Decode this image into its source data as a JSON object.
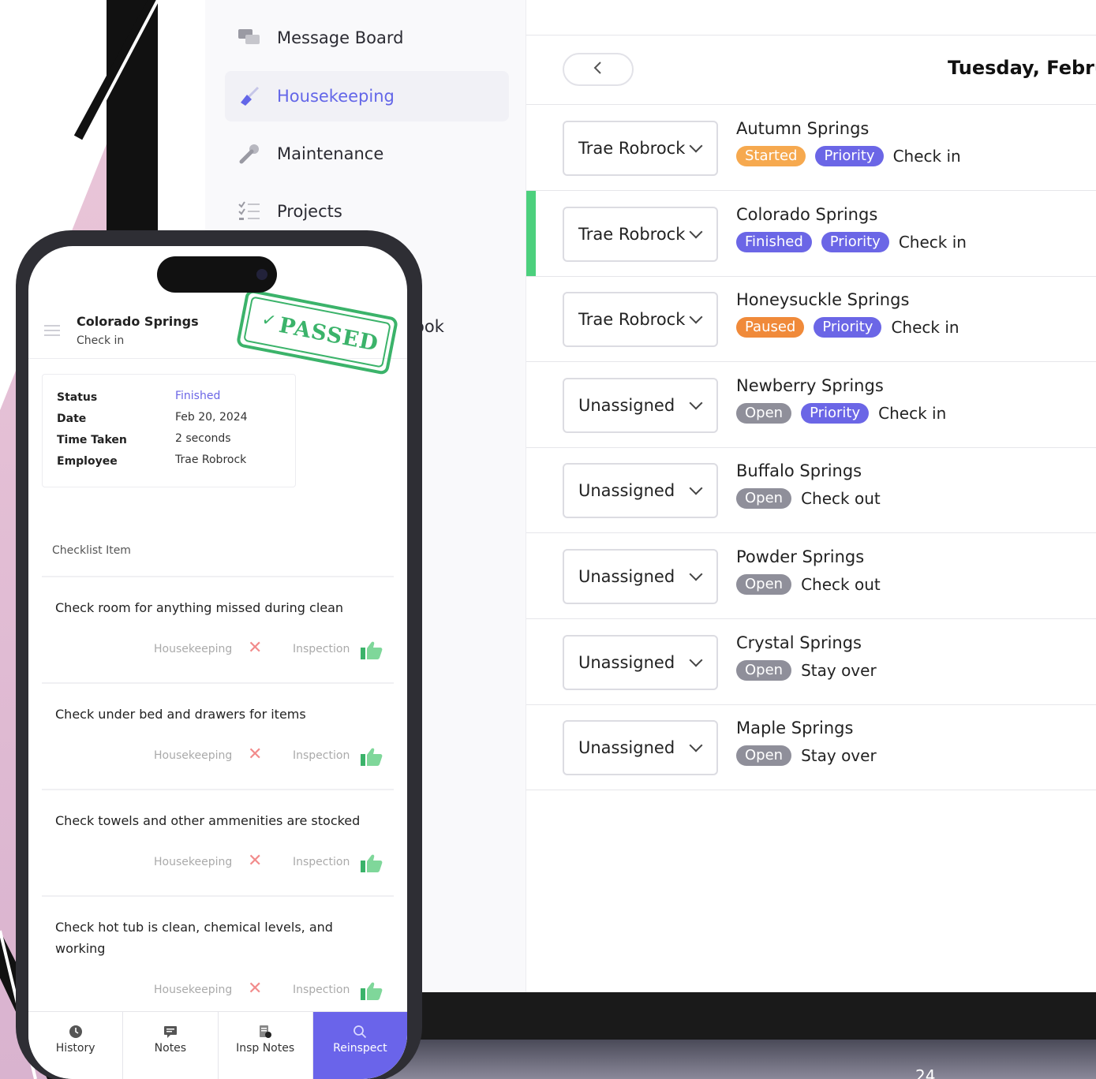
{
  "colors": {
    "accent": "#6366e8",
    "started": "#f6a94f",
    "paused": "#f08a3a",
    "finished": "#6b66e6",
    "priority": "#6b66e6",
    "open": "#8f8f9a",
    "active_row": "#4cd07d",
    "passed_stamp": "#3bb36a"
  },
  "sidebar": {
    "items": [
      {
        "label": "Message Board",
        "icon": "chat-bubbles-icon"
      },
      {
        "label": "Housekeeping",
        "icon": "broom-icon",
        "active": true
      },
      {
        "label": "Maintenance",
        "icon": "wrench-icon"
      },
      {
        "label": "Projects",
        "icon": "checklist-icon"
      }
    ],
    "partial_label": "ook"
  },
  "main": {
    "back_icon": "chevron-left-icon",
    "date_title": "Tuesday, Februa",
    "rows": [
      {
        "assignee": "Trae Robrock",
        "property": "Autumn Springs",
        "status": "Started",
        "priority": "Priority",
        "type": "Check in"
      },
      {
        "assignee": "Trae Robrock",
        "property": "Colorado Springs",
        "status": "Finished",
        "priority": "Priority",
        "type": "Check in",
        "selected": true
      },
      {
        "assignee": "Trae Robrock",
        "property": "Honeysuckle Springs",
        "status": "Paused",
        "priority": "Priority",
        "type": "Check in"
      },
      {
        "assignee": "Unassigned",
        "property": "Newberry Springs",
        "status": "Open",
        "priority": "Priority",
        "type": "Check in"
      },
      {
        "assignee": "Unassigned",
        "property": "Buffalo Springs",
        "status": "Open",
        "priority": "",
        "type": "Check out"
      },
      {
        "assignee": "Unassigned",
        "property": "Powder Springs",
        "status": "Open",
        "priority": "",
        "type": "Check out"
      },
      {
        "assignee": "Unassigned",
        "property": "Crystal Springs",
        "status": "Open",
        "priority": "",
        "type": "Stay over"
      },
      {
        "assignee": "Unassigned",
        "property": "Maple Springs",
        "status": "Open",
        "priority": "",
        "type": "Stay over"
      }
    ]
  },
  "phone": {
    "title": "Colorado Springs",
    "subtitle": "Check in",
    "stamp": "PASSED",
    "details": [
      {
        "key": "Status",
        "value": "Finished"
      },
      {
        "key": "Date",
        "value": "Feb 20, 2024"
      },
      {
        "key": "Time Taken",
        "value": "2 seconds"
      },
      {
        "key": "Employee",
        "value": "Trae Robrock"
      }
    ],
    "checklist_header": "Checklist Item",
    "checklist": [
      {
        "text": "Check room for anything missed during clean",
        "hk": "Housekeeping",
        "insp": "Inspection"
      },
      {
        "text": "Check under bed and drawers for items",
        "hk": "Housekeeping",
        "insp": "Inspection"
      },
      {
        "text": "Check towels and other ammenities are stocked",
        "hk": "Housekeeping",
        "insp": "Inspection"
      },
      {
        "text": "Check hot tub is clean, chemical levels, and working",
        "hk": "Housekeeping",
        "insp": "Inspection"
      }
    ],
    "tabs": [
      {
        "label": "History",
        "icon": "clock-icon"
      },
      {
        "label": "Notes",
        "icon": "notes-icon"
      },
      {
        "label": "Insp Notes",
        "icon": "insp-notes-icon"
      },
      {
        "label": "Reinspect",
        "icon": "search-icon",
        "active": true
      }
    ]
  },
  "page_number": "24"
}
